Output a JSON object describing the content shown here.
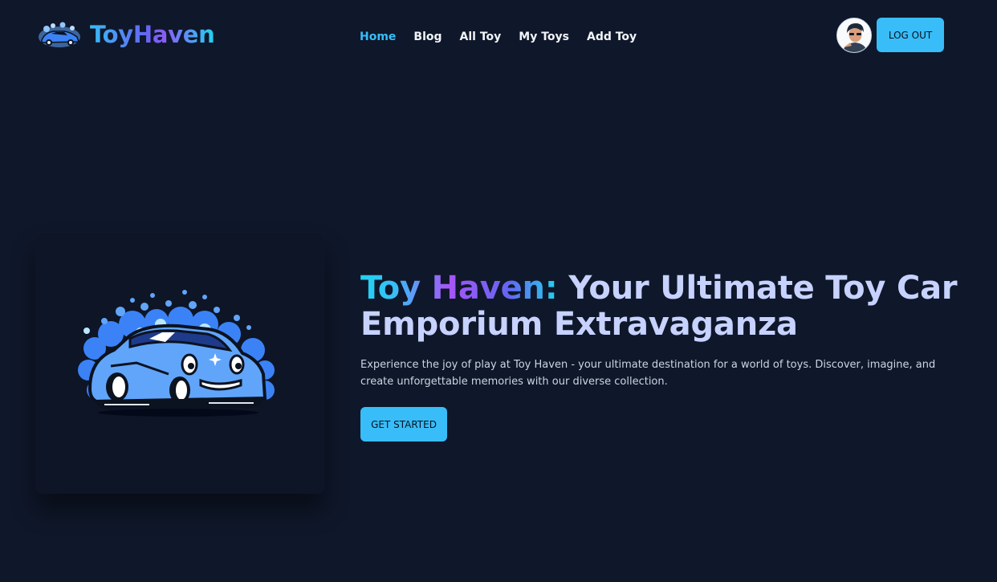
{
  "brand": {
    "name": "ToyHaven",
    "logo_icon": "toy-car-logo-icon"
  },
  "nav": {
    "items": [
      {
        "label": "Home",
        "active": true
      },
      {
        "label": "Blog",
        "active": false
      },
      {
        "label": "All Toy",
        "active": false
      },
      {
        "label": "My Toys",
        "active": false
      },
      {
        "label": "Add Toy",
        "active": false
      }
    ]
  },
  "user": {
    "avatar_icon": "user-avatar",
    "logout_label": "LOG OUT"
  },
  "hero": {
    "title_highlight": "Toy Haven:",
    "title_rest": " Your Ultimate Toy Car Emporium Extravaganza",
    "description": "Experience the joy of play at Toy Haven - your ultimate destination for a world of toys. Discover, imagine, and create unforgettable memories with our diverse collection.",
    "cta_label": "GET STARTED",
    "image_icon": "toy-car-illustration"
  },
  "colors": {
    "background": "#0f172a",
    "accent": "#38bdf8",
    "title_text": "#c7d2fe"
  }
}
